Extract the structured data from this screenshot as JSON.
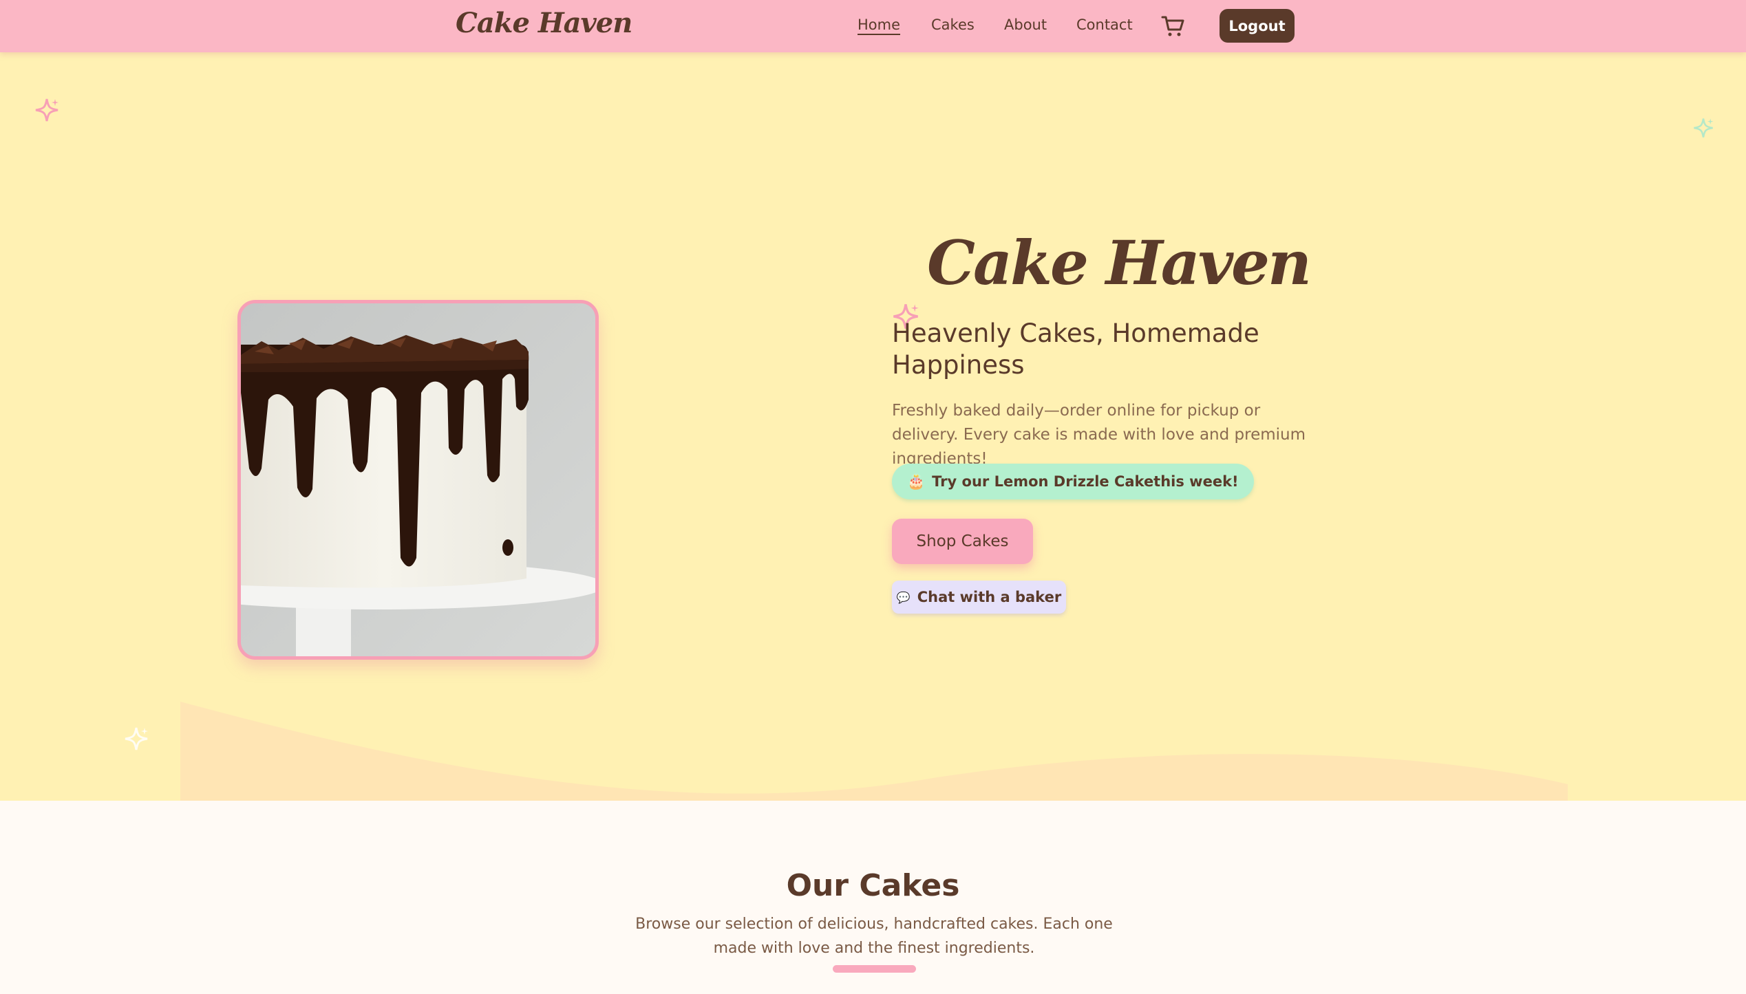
{
  "nav": {
    "logo": "Cake Haven",
    "links": [
      "Home",
      "Cakes",
      "About",
      "Contact"
    ],
    "logout_label": "Logout"
  },
  "hero": {
    "title": "Cake Haven",
    "subtitle": "Heavenly Cakes, Homemade Happiness",
    "description": "Freshly baked daily—order online for pickup or delivery. Every cake is made with love and premium ingredients!",
    "promo_icon": "🎂",
    "promo_text": "Try our Lemon Drizzle Cakethis week!",
    "shop_label": "Shop Cakes",
    "chat_icon": "💬",
    "chat_label": "Chat with a baker",
    "image_alt": "chocolate drip cake"
  },
  "section": {
    "title": "Our Cakes",
    "description": "Browse our selection of delicious, handcrafted cakes. Each one made with love and the finest ingredients."
  },
  "colors": {
    "nav_bg": "#fbb7c5",
    "hero_bg": "#fff1b3",
    "brown": "#5a3a2a",
    "pink": "#f9a9bd",
    "mint": "#b4f0cf",
    "lavender": "#e6e1fa"
  }
}
